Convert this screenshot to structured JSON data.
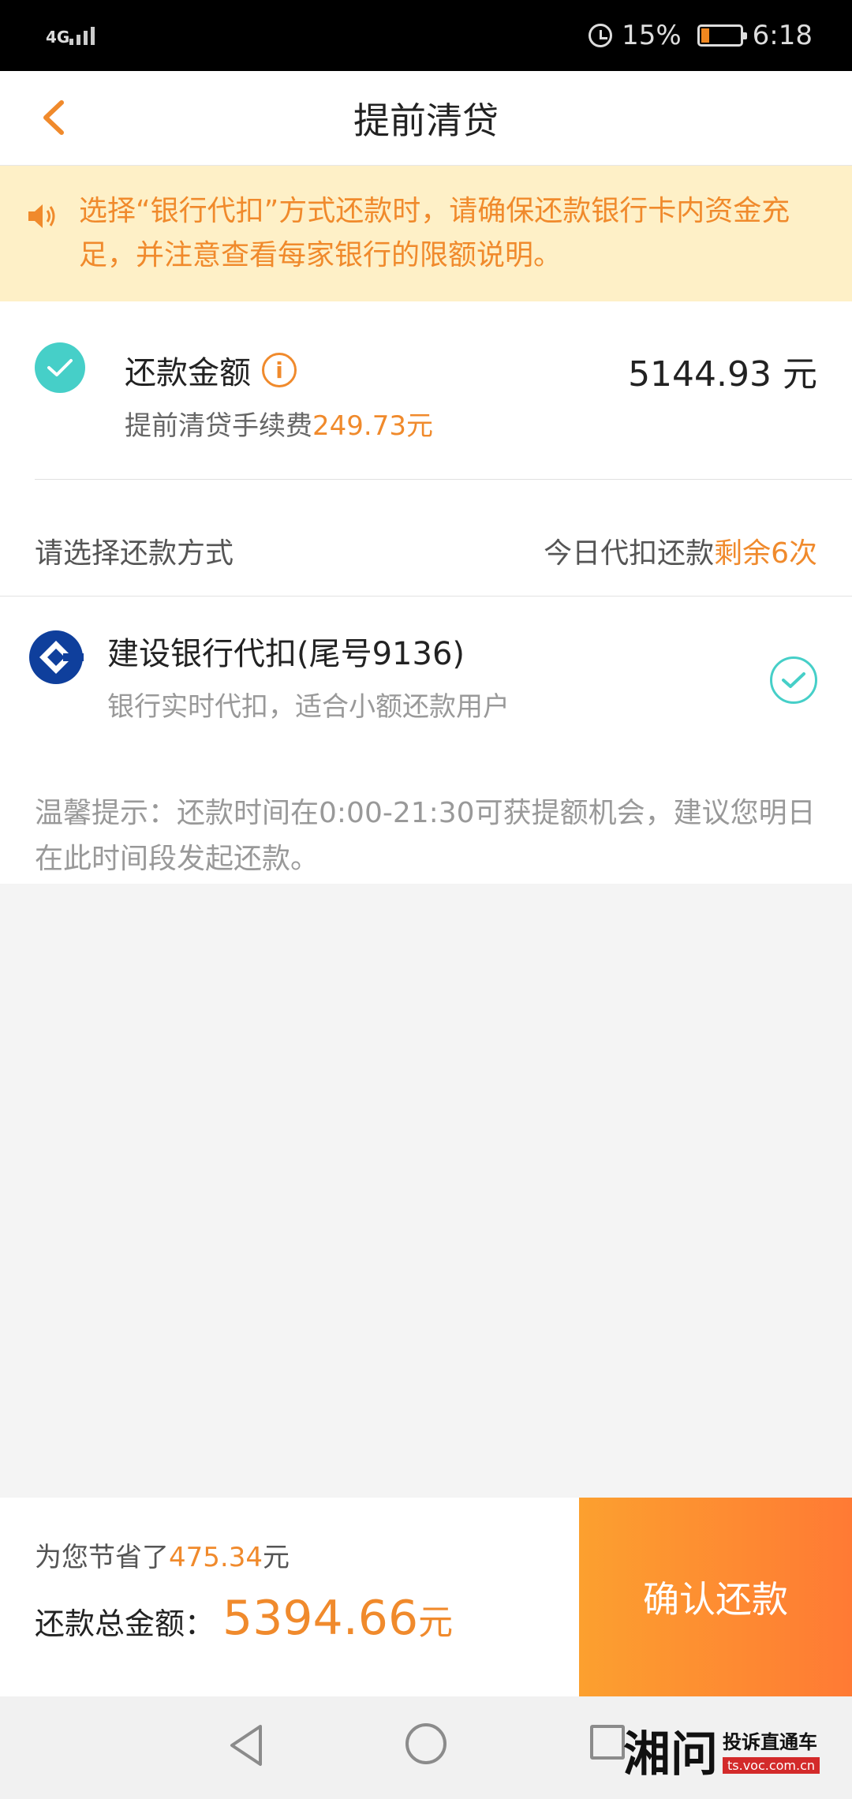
{
  "status_bar": {
    "network": "4G",
    "battery_percent": "15%",
    "time": "6:18",
    "battery_level": 0.15
  },
  "nav": {
    "title": "提前清贷"
  },
  "notice": {
    "text": "选择“银行代扣”方式还款时，请确保还款银行卡内资金充足，并注意查看每家银行的限额说明。"
  },
  "amount": {
    "label": "还款金额",
    "value": "5144.93 元",
    "fee_label": "提前清贷手续费",
    "fee_value": "249.73元"
  },
  "payment_method": {
    "title": "请选择还款方式",
    "remain_label": "今日代扣还款",
    "remain_value": "剩余6次"
  },
  "bank": {
    "name": "建设银行代扣(尾号9136)",
    "desc": "银行实时代扣，适合小额还款用户"
  },
  "tip": {
    "text": "温馨提示：还款时间在0:00-21:30可获提额机会，建议您明日在此时间段发起还款。"
  },
  "bottom": {
    "saved_label": "为您节省了",
    "saved_value": "475.34",
    "saved_unit": "元",
    "total_label": "还款总金额：",
    "total_value": "5394.66",
    "total_unit": "元",
    "confirm_label": "确认还款"
  },
  "watermark": {
    "logo": "湘问",
    "line1": "投诉直通车",
    "line2": "ts.voc.com.cn"
  },
  "colors": {
    "accent": "#f08a2c",
    "teal": "#46cfc8",
    "notice_bg": "#fef0c7"
  }
}
